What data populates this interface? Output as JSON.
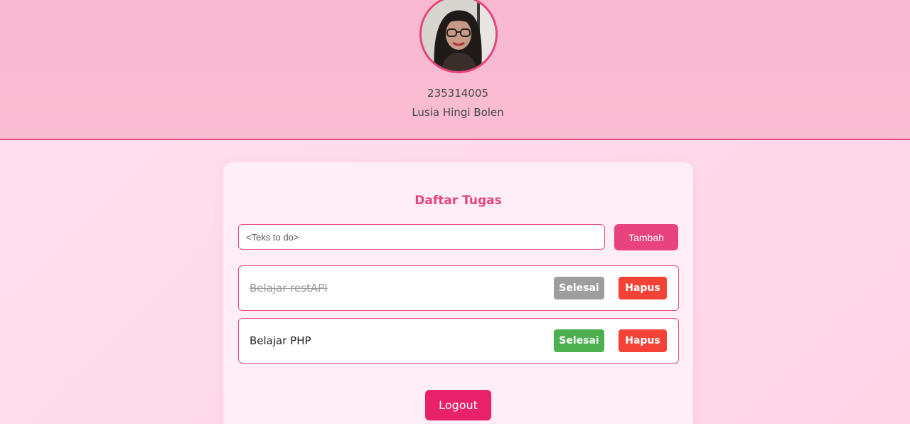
{
  "profile": {
    "nim": "235314005",
    "name": "Lusia Hingi Bolen"
  },
  "todo": {
    "title": "Daftar Tugas",
    "input_placeholder": "<Teks to do>",
    "input_value": "",
    "add_label": "Tambah",
    "tasks": [
      {
        "text": "Belajar restAPI",
        "completed": true,
        "done_label": "Selesai",
        "delete_label": "Hapus"
      },
      {
        "text": "Belajar PHP",
        "completed": false,
        "done_label": "Selesai",
        "delete_label": "Hapus"
      }
    ]
  },
  "logout_label": "Logout",
  "colors": {
    "accent": "#e8437c",
    "done_gray": "#9e9e9e",
    "done_green": "#4caf50",
    "delete_red": "#f44336",
    "logout": "#e8216b"
  }
}
